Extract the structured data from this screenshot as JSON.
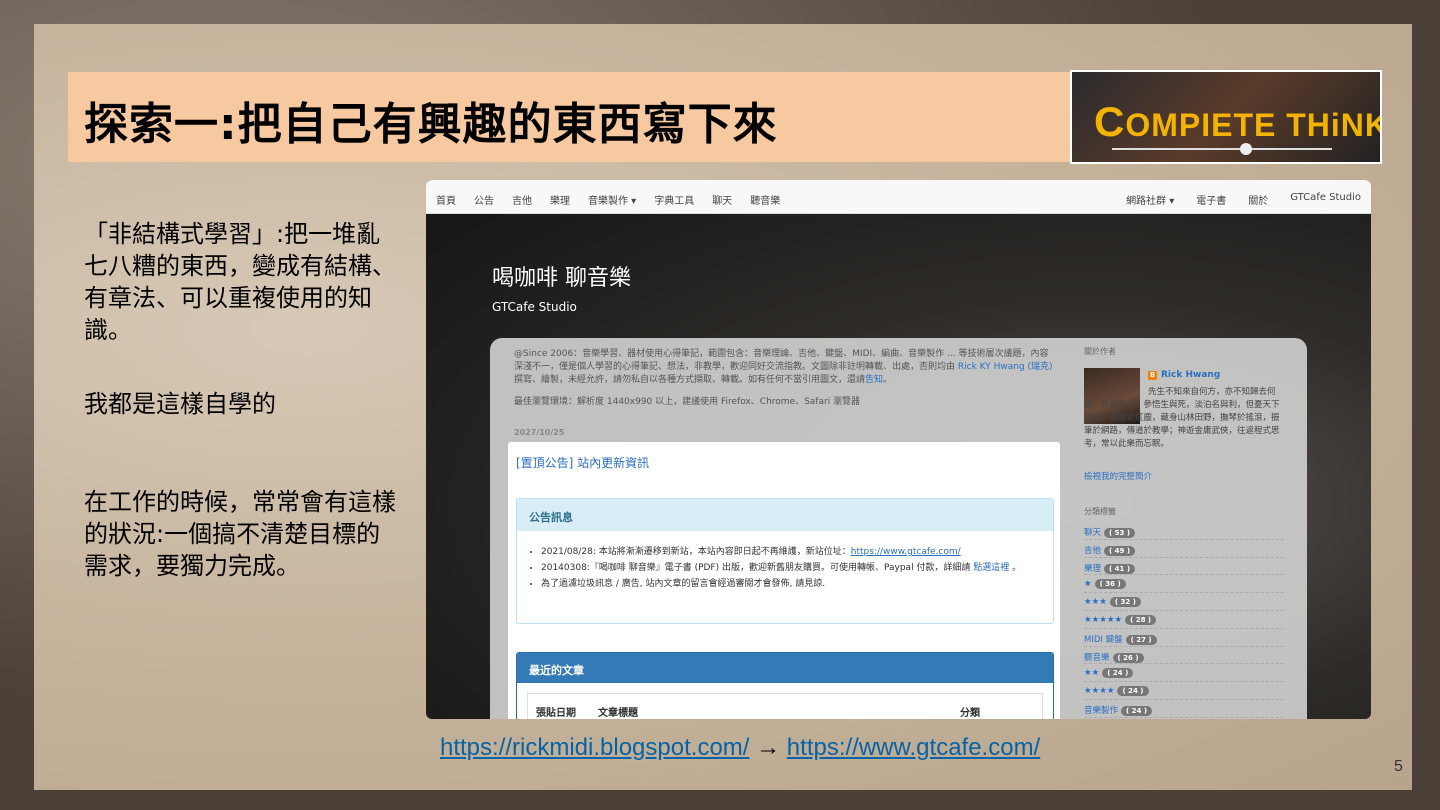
{
  "slide": {
    "title": "探索一:把自己有興趣的東西寫下來",
    "logo_text_c": "C",
    "logo_text_rest": "OMPIETE T",
    "logo_text_h": "HiNK",
    "para1": "「非結構式學習」:把一堆亂七八糟的東西，變成有結構、有章法、可以重複使用的知識。",
    "para2": "我都是這樣自學的",
    "para3": "在工作的時候，常常會有這樣的狀況:一個搞不清楚目標的需求，要獨力完成。",
    "url1": "https://rickmidi.blogspot.com/",
    "arrow": " → ",
    "url2": "https://www.gtcafe.com/",
    "page_number": "5"
  },
  "site": {
    "nav_left": [
      "首頁",
      "公告",
      "吉他",
      "樂理",
      "音樂製作 ▾",
      "字典工具",
      "聊天",
      "聽音樂"
    ],
    "nav_right": [
      "網路社群 ▾",
      "電子書",
      "關於",
      "GTCafe Studio"
    ],
    "title": "喝咖啡 聊音樂",
    "subtitle": "GTCafe Studio",
    "intro_text": "@Since 2006：音樂學習、器材使用心得筆記，範圍包含：音樂理論、吉他、鍵盤、MIDI、編曲、音樂製作 ... 等技術層次議題，內容深淺不一，僅是個人學習的心得筆記、想法，非教學，歡迎同好交流指教。文圖除非註明轉載、出處，否則均由 ",
    "intro_link": "Rick KY Hwang (瑞克)",
    "intro_text2": " 撰寫、繪製，未經允許，請勿私自以各種方式擷取、轉載。如有任何不當引用圖文，還請",
    "intro_link2": "告知",
    "intro_end": "。",
    "browser_note": "最佳瀏覽環境：解析度 1440x990 以上，建議使用 Firefox、Chrome、Safari 瀏覽器",
    "date": "2027/10/25",
    "pinned_title": "[置頂公告] 站內更新資訊",
    "ann_header": "公告訊息",
    "ann_1": "2021/08/28: 本站將漸漸遷移到新站，本站內容即日起不再維護，新站位址：",
    "ann_1_link": "https://www.gtcafe.com/",
    "ann_2": "20140308:『喝咖啡 聊音樂』電子書 (PDF) 出版，歡迎新舊朋友購買。可使用轉帳、Paypal 付款，詳細請 ",
    "ann_2_link": "點選這裡",
    "ann_2_end": " 。",
    "ann_3": "為了過濾垃圾訊息 / 廣告, 站內文章的留言會經過審閱才會發佈, 請見諒.",
    "recent_header": "最近的文章",
    "col_date": "張貼日期",
    "col_title": "文章標題",
    "col_cat": "分類",
    "sidebar_author_heading": "關於作者",
    "author_name": "Rick Hwang",
    "author_bio": "先生不知來自何方，亦不知歸去何處，年過而立，參悟生與死，淡泊名與利，但憂天下蒼生。蹤跡走紅塵，藏身山林田野，撫琴於搖滾，振筆於網路，傳道於教學；神遊金庸武俠，往返程式思考，常以此樂而忘眠。",
    "profile_link": "檢視我的完整簡介",
    "labels_heading": "分類標籤",
    "labels": [
      {
        "name": "聊天",
        "count": "53"
      },
      {
        "name": "吉他",
        "count": "49"
      },
      {
        "name": "樂理",
        "count": "41"
      },
      {
        "name": "★",
        "count": "36"
      },
      {
        "name": "★★★",
        "count": "32"
      },
      {
        "name": "★★★★★",
        "count": "28"
      },
      {
        "name": "MIDI 鍵盤",
        "count": "27"
      },
      {
        "name": "聽音樂",
        "count": "26"
      },
      {
        "name": "★★",
        "count": "24"
      },
      {
        "name": "★★★★",
        "count": "24"
      },
      {
        "name": "音樂製作",
        "count": "24"
      }
    ]
  }
}
